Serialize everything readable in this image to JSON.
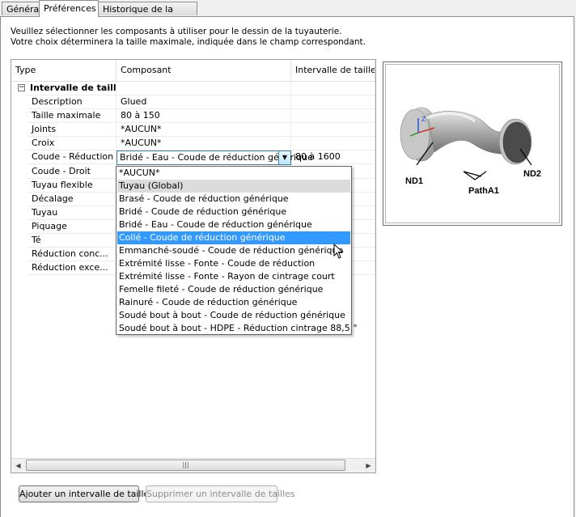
{
  "tabs": [
    {
      "label": "Général"
    },
    {
      "label": "Préférences"
    },
    {
      "label": "Historique de la version"
    }
  ],
  "intro_text": "Veuillez sélectionner les composants à utiliser pour le dessin de la tuyauterie. Votre choix déterminera la taille maximale, indiquée dans le champ correspondant.",
  "grid": {
    "columns": [
      "Type",
      "Composant",
      "Intervalle de tailles d"
    ],
    "group_label": "Intervalle de taill...",
    "group_toggle": "−",
    "rows": [
      {
        "type": "Description",
        "component": "Glued",
        "range": ""
      },
      {
        "type": "Taille maximale",
        "component": "80 à 150",
        "range": ""
      },
      {
        "type": "Joints",
        "component": "*AUCUN*",
        "range": ""
      },
      {
        "type": "Croix",
        "component": "*AUCUN*",
        "range": ""
      },
      {
        "type": "Coude - Réduction",
        "component": "Bridé - Eau - Coude de réduction générique",
        "range": "80 à 1600"
      },
      {
        "type": "Coude - Droit",
        "component": "",
        "range": ""
      },
      {
        "type": "Tuyau flexible",
        "component": "",
        "range": ""
      },
      {
        "type": "Décalage",
        "component": "",
        "range": ""
      },
      {
        "type": "Tuyau",
        "component": "",
        "range": ""
      },
      {
        "type": "Piquage",
        "component": "",
        "range": ""
      },
      {
        "type": "Té",
        "component": "",
        "range": ""
      },
      {
        "type": "Réduction conc...",
        "component": "",
        "range": ""
      },
      {
        "type": "Réduction exce...",
        "component": "",
        "range": ""
      }
    ]
  },
  "dropdown": {
    "options": [
      "*AUCUN*",
      "Tuyau (Global)",
      "Brasé - Coude de réduction générique",
      "Bridé - Coude de réduction générique",
      "Bridé - Eau - Coude de réduction générique",
      "Collé - Coude de réduction générique",
      "Emmanché-soudé - Coude de réduction générique",
      "Extrémité lisse - Fonte - Coude de réduction",
      "Extrémité lisse - Fonte - Rayon de cintrage court",
      "Femelle fileté - Coude de réduction générique",
      "Rainuré - Coude de réduction générique",
      "Soudé bout à bout - Coude de réduction générique",
      "Soudé bout à bout - HDPE - Réduction cintrage 88,5 °"
    ],
    "selected_index": 1,
    "highlighted_index": 5
  },
  "preview": {
    "label_nd1": "ND1",
    "label_nd2": "ND2",
    "label_path": "PathA1",
    "axis_z": "Z"
  },
  "buttons": {
    "add": "Ajouter un intervalle de tailles",
    "remove": "Supprimer un intervalle de tailles"
  },
  "colors": {
    "highlight": "#3399ff",
    "selected": "#dcdcdc",
    "combo_border": "#3c7fb1"
  }
}
